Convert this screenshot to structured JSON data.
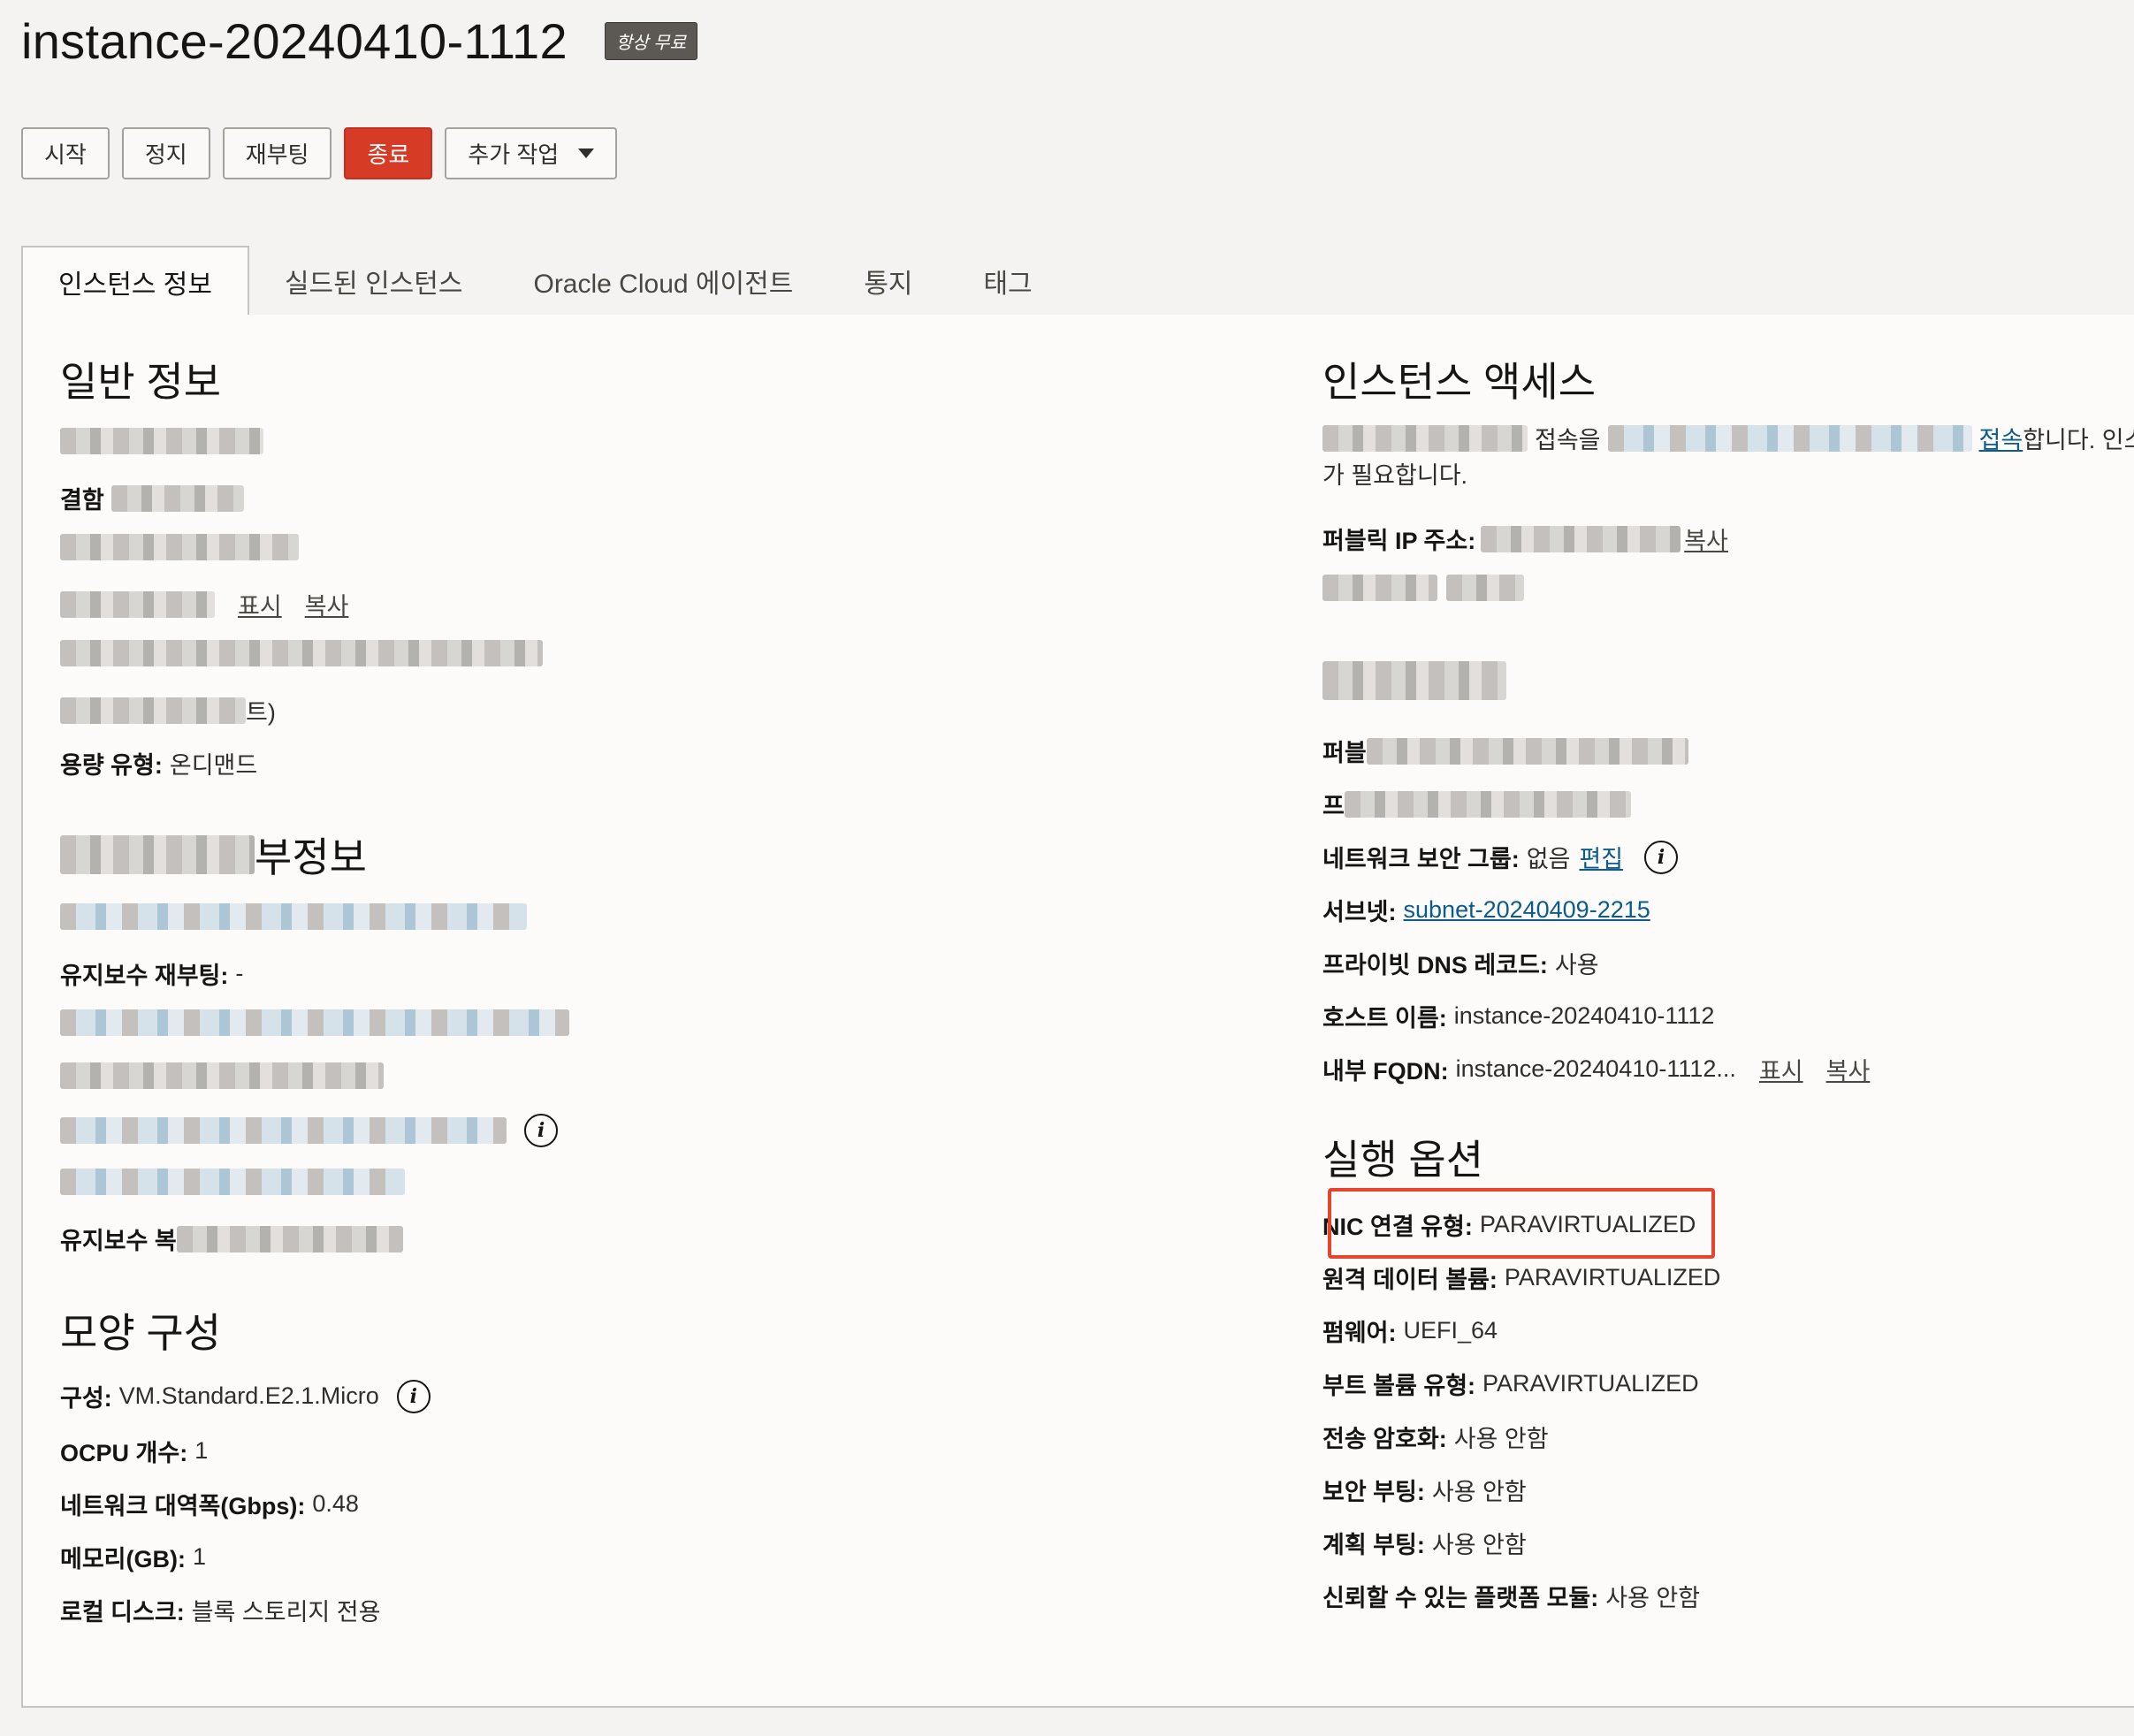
{
  "header": {
    "title": "instance-20240410-1112",
    "badge": "항상 무료"
  },
  "actions": {
    "start": "시작",
    "stop": "정지",
    "reboot": "재부팅",
    "terminate": "종료",
    "more": "추가 작업"
  },
  "tabs": [
    "인스턴스 정보",
    "실드된 인스턴스",
    "Oracle Cloud 에이전트",
    "통지",
    "태그"
  ],
  "general": {
    "title": "일반 정보",
    "fault_label": "결함",
    "show": "표시",
    "copy": "복사",
    "suffix_text": "트)",
    "capacity_label": "용량 유형:",
    "capacity_value": "온디맨드"
  },
  "maintenance": {
    "title_suffix": "부정보",
    "reboot_label": "유지보수 재부팅:",
    "reboot_value": "-",
    "recovery_label": "유지보수 복"
  },
  "shape": {
    "title": "모양 구성",
    "rows": [
      {
        "label": "구성:",
        "value": "VM.Standard.E2.1.Micro"
      },
      {
        "label": "OCPU 개수:",
        "value": "1"
      },
      {
        "label": "네트워크 대역폭(Gbps):",
        "value": "0.48"
      },
      {
        "label": "메모리(GB):",
        "value": "1"
      },
      {
        "label": "로컬 디스크:",
        "value": "블록 스토리지 전용"
      }
    ]
  },
  "access": {
    "title": "인스턴스 액세스",
    "intro_mid": "접속을",
    "intro_link": "접속",
    "intro_tail": "합니다. 인스",
    "intro_line2": "가 필요합니다.",
    "public_ip_label": "퍼블릭 IP 주소:",
    "public_ip_copy": "복사",
    "public_label_frag": "퍼블",
    "private_label_frag": "프",
    "nsg_label": "네트워크 보안 그룹:",
    "nsg_value": "없음",
    "nsg_edit": "편집",
    "subnet_label": "서브넷:",
    "subnet_value": "subnet-20240409-2215",
    "dns_label": "프라이빗 DNS 레코드:",
    "dns_value": "사용",
    "host_label": "호스트 이름:",
    "host_value": "instance-20240410-1112",
    "fqdn_label": "내부 FQDN:",
    "fqdn_value": "instance-20240410-1112...",
    "show": "표시",
    "copy": "복사"
  },
  "launch": {
    "title": "실행 옵션",
    "rows": [
      {
        "label": "NIC 연결 유형:",
        "value": "PARAVIRTUALIZED"
      },
      {
        "label": "원격 데이터 볼륨:",
        "value": "PARAVIRTUALIZED"
      },
      {
        "label": "펌웨어:",
        "value": "UEFI_64"
      },
      {
        "label": "부트 볼륨 유형:",
        "value": "PARAVIRTUALIZED"
      },
      {
        "label": "전송 암호화:",
        "value": "사용 안함"
      },
      {
        "label": "보안 부팅:",
        "value": "사용 안함"
      },
      {
        "label": "계획 부팅:",
        "value": "사용 안함"
      },
      {
        "label": "신뢰할 수 있는 플랫폼 모듈:",
        "value": "사용 안함"
      }
    ]
  },
  "colors": {
    "danger": "#d63b25",
    "link": "#0b5c8c",
    "highlight": "#e5452d"
  }
}
